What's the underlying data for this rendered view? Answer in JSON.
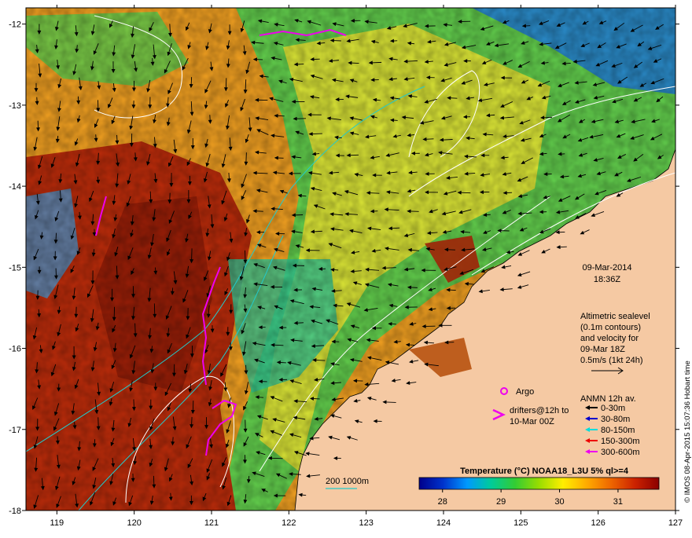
{
  "map": {
    "lon_ticks": [
      "119",
      "120",
      "121",
      "122",
      "123",
      "124",
      "125",
      "126",
      "127"
    ],
    "lat_ticks": [
      "-12",
      "-13",
      "-14",
      "-15",
      "-16",
      "-17",
      "-18"
    ],
    "lon_range": [
      118.6,
      127.0
    ],
    "lat_range": [
      -11.8,
      -18.0
    ],
    "date": "09-Mar-2014",
    "time": "18:36Z",
    "altimetry_label": [
      "Altimetric sealevel",
      "(0.1m contours)",
      "and velocity for",
      "09-Mar 18Z",
      "0.5m/s (1kt 24h)"
    ],
    "argo_label": "Argo",
    "drifters_label": [
      "drifters@12h to",
      "10-Mar 00Z"
    ],
    "anmn_title": "ANMN 12h av.",
    "anmn_legend": [
      {
        "label": "0-30m",
        "color": "#000000"
      },
      {
        "label": "30-80m",
        "color": "#0000cc"
      },
      {
        "label": "80-150m",
        "color": "#00dddd"
      },
      {
        "label": "150-300m",
        "color": "#ee0000"
      },
      {
        "label": "300-600m",
        "color": "#ee00ee"
      }
    ],
    "bathy_label": "200  1000m",
    "colorbar": {
      "title": "Temperature (°C) NOAA18_L3U 5% ql>=4",
      "ticks": [
        "28",
        "29",
        "30",
        "31"
      ],
      "range": [
        27.6,
        31.7
      ],
      "colors": [
        "#00008b",
        "#0033cc",
        "#0099ff",
        "#00cc99",
        "#33cc33",
        "#99dd00",
        "#ffee00",
        "#ffaa00",
        "#ee6600",
        "#cc2200",
        "#8b0000"
      ]
    },
    "credit": "© IMOS 08-Apr-2015 15:07:36 Hobart time",
    "colors": {
      "land": "#f5c9a3",
      "warm": "#b52a0a",
      "mid": "#e89a20",
      "cool": "#5fc84a",
      "cold": "#1e78d4",
      "argo": "#ee00ee",
      "contour": "#ffffff",
      "bathy": "#22cccc"
    }
  }
}
